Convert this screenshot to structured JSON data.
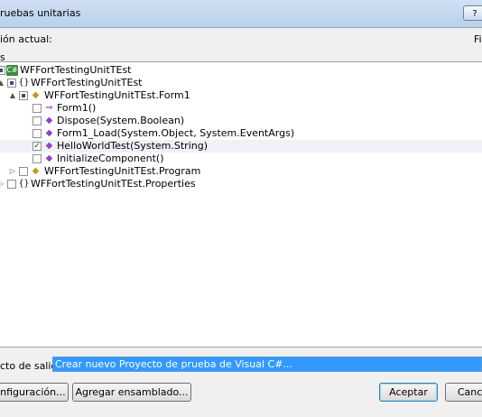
{
  "window": {
    "title": "ruebas unitarias",
    "help_label": "?"
  },
  "labels": {
    "current_selection": "ión actual:",
    "filter": "Fil",
    "types": "s",
    "output_project": "cto de salida:"
  },
  "tree": {
    "items": [
      {
        "label": "WFFortTestingUnitTEst",
        "icon": "project-icon",
        "expander": "",
        "check": "partial"
      },
      {
        "label": "WFFortTestingUnitTEst",
        "icon": "namespace-icon",
        "expander": "▲",
        "check": "partial"
      },
      {
        "label": "WFFortTestingUnitTEst.Form1",
        "icon": "class-icon",
        "expander": "▲",
        "check": "partial"
      },
      {
        "label": "Form1()",
        "icon": "constructor-icon",
        "expander": "",
        "check": "none"
      },
      {
        "label": "Dispose(System.Boolean)",
        "icon": "protected-method-icon",
        "expander": "",
        "check": "none"
      },
      {
        "label": "Form1_Load(System.Object, System.EventArgs)",
        "icon": "private-method-icon",
        "expander": "",
        "check": "none"
      },
      {
        "label": "HelloWorldTest(System.String)",
        "icon": "method-icon",
        "expander": "",
        "check": "checked"
      },
      {
        "label": "InitializeComponent()",
        "icon": "private-method-icon",
        "expander": "",
        "check": "none"
      },
      {
        "label": "WFFortTestingUnitTEst.Program",
        "icon": "class-icon",
        "expander": "▷",
        "check": "none"
      },
      {
        "label": "WFFortTestingUnitTEst.Properties",
        "icon": "namespace-icon",
        "expander": "▷",
        "check": "none"
      }
    ]
  },
  "output": {
    "selected_value": "Crear nuevo Proyecto de prueba de Visual C#..."
  },
  "buttons": {
    "configuration": "onfiguración...",
    "add_assembly": "Agregar ensamblado...",
    "accept": "Aceptar",
    "cancel": "Cancel"
  }
}
